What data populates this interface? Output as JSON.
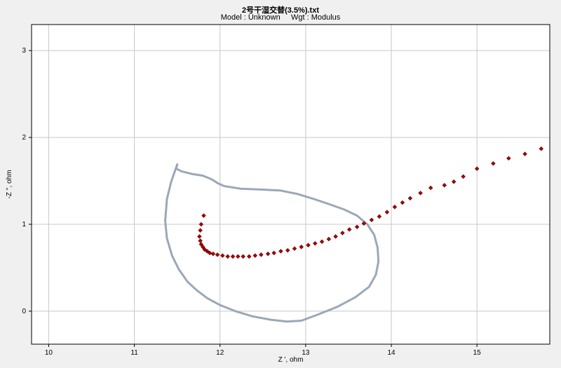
{
  "header": {
    "title": "2号干湿交替(3.5%).txt",
    "subtitle": "Model : Unknown     Wgt : Modulus"
  },
  "colors": {
    "background": "#f0f0f0",
    "plot_area": "#ffffff",
    "grid": "#c8c8c8",
    "points": "#aa0000",
    "annotation_outline": "#9aa8b8"
  },
  "chart_data": {
    "type": "scatter",
    "xlabel": "Z ', ohm",
    "ylabel": "-Z '', ohm",
    "xlim": [
      9.8,
      15.85
    ],
    "ylim": [
      -0.38,
      3.3
    ],
    "xticks": [
      10,
      11,
      12,
      13,
      14,
      15
    ],
    "yticks": [
      0,
      1,
      2,
      3
    ],
    "grid": true,
    "series": [
      {
        "x": [
          11.81,
          11.78,
          11.77,
          11.76,
          11.77,
          11.78,
          11.8,
          11.82,
          11.85,
          11.88,
          11.92,
          11.97,
          12.03,
          12.09,
          12.15,
          12.21,
          12.27,
          12.34,
          12.41,
          12.48,
          12.56,
          12.63,
          12.71,
          12.79,
          12.87,
          12.95,
          13.03,
          13.11,
          13.19,
          13.27,
          13.35,
          13.43,
          13.51,
          13.6,
          13.68,
          13.77,
          13.86,
          13.95,
          14.04,
          14.13,
          14.22,
          14.34,
          14.46,
          14.62,
          14.73,
          14.84,
          15.0,
          15.19,
          15.37,
          15.56,
          15.75
        ],
        "y": [
          1.1,
          1.0,
          0.93,
          0.86,
          0.81,
          0.77,
          0.74,
          0.71,
          0.69,
          0.67,
          0.66,
          0.65,
          0.64,
          0.63,
          0.63,
          0.63,
          0.63,
          0.63,
          0.64,
          0.65,
          0.66,
          0.67,
          0.69,
          0.7,
          0.72,
          0.74,
          0.76,
          0.78,
          0.8,
          0.83,
          0.86,
          0.9,
          0.94,
          0.97,
          1.01,
          1.05,
          1.09,
          1.14,
          1.2,
          1.25,
          1.3,
          1.36,
          1.42,
          1.45,
          1.49,
          1.55,
          1.64,
          1.7,
          1.76,
          1.81,
          1.87
        ]
      }
    ],
    "annotation_outline": {
      "x": [
        11.5,
        11.48,
        11.43,
        11.38,
        11.36,
        11.38,
        11.44,
        11.52,
        11.62,
        11.73,
        11.85,
        12.0,
        12.18,
        12.38,
        12.6,
        12.78,
        12.95,
        13.14,
        13.37,
        13.58,
        13.74,
        13.82,
        13.85,
        13.84,
        13.8,
        13.72,
        13.6,
        13.45,
        13.28,
        13.1,
        12.9,
        12.7,
        12.48,
        12.24,
        12.05,
        11.98,
        11.9,
        11.8,
        11.67,
        11.55,
        11.49,
        11.5
      ],
      "y": [
        1.69,
        1.63,
        1.49,
        1.29,
        1.04,
        0.84,
        0.64,
        0.48,
        0.34,
        0.24,
        0.15,
        0.07,
        0.0,
        -0.06,
        -0.1,
        -0.12,
        -0.11,
        -0.04,
        0.05,
        0.16,
        0.28,
        0.42,
        0.57,
        0.73,
        0.88,
        1.0,
        1.1,
        1.17,
        1.23,
        1.29,
        1.35,
        1.39,
        1.4,
        1.41,
        1.44,
        1.47,
        1.52,
        1.56,
        1.58,
        1.61,
        1.64,
        1.69
      ]
    }
  }
}
